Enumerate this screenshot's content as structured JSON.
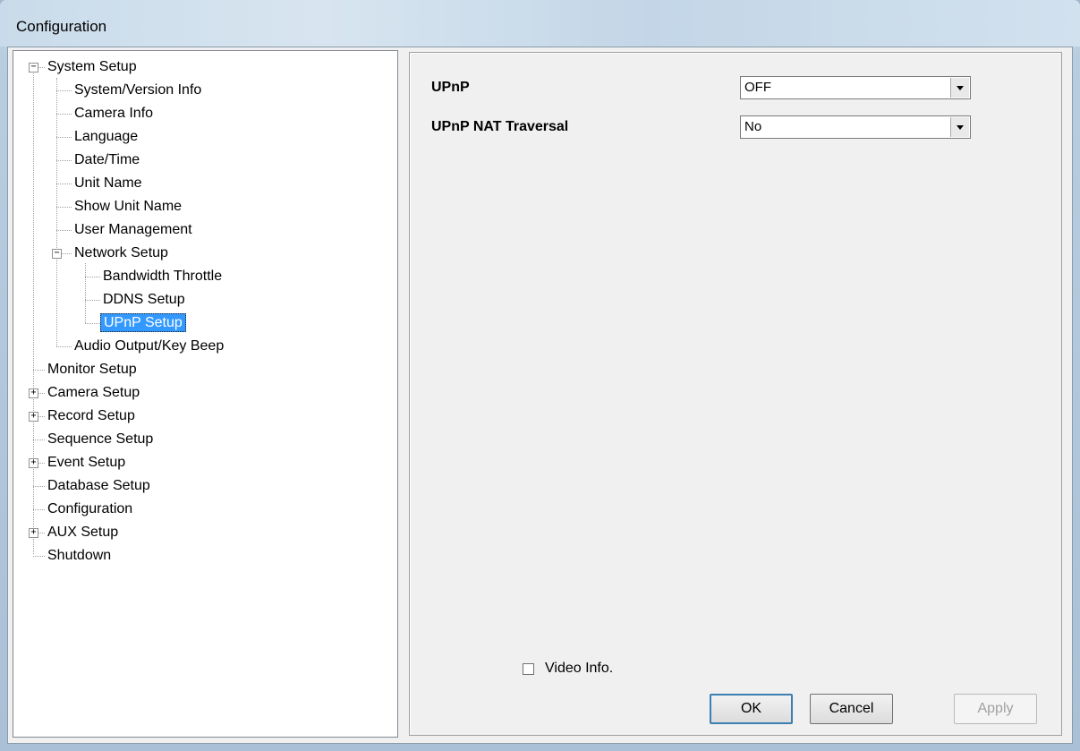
{
  "window": {
    "title": "Configuration"
  },
  "tree": {
    "items": [
      {
        "label": "System Setup",
        "level": 0,
        "expander": "minus"
      },
      {
        "label": "System/Version Info",
        "level": 1
      },
      {
        "label": "Camera Info",
        "level": 1
      },
      {
        "label": "Language",
        "level": 1
      },
      {
        "label": "Date/Time",
        "level": 1
      },
      {
        "label": "Unit Name",
        "level": 1
      },
      {
        "label": "Show Unit Name",
        "level": 1
      },
      {
        "label": "User Management",
        "level": 1
      },
      {
        "label": "Network Setup",
        "level": 1,
        "expander": "minus"
      },
      {
        "label": "Bandwidth Throttle",
        "level": 2
      },
      {
        "label": "DDNS Setup",
        "level": 2
      },
      {
        "label": "UPnP Setup",
        "level": 2,
        "selected": true
      },
      {
        "label": "Audio Output/Key Beep",
        "level": 1
      },
      {
        "label": "Monitor Setup",
        "level": 0
      },
      {
        "label": "Camera Setup",
        "level": 0,
        "expander": "plus"
      },
      {
        "label": "Record Setup",
        "level": 0,
        "expander": "plus"
      },
      {
        "label": "Sequence Setup",
        "level": 0
      },
      {
        "label": "Event Setup",
        "level": 0,
        "expander": "plus"
      },
      {
        "label": "Database Setup",
        "level": 0
      },
      {
        "label": "Configuration",
        "level": 0
      },
      {
        "label": "AUX Setup",
        "level": 0,
        "expander": "plus"
      },
      {
        "label": "Shutdown",
        "level": 0
      }
    ]
  },
  "settings": {
    "upnp": {
      "label": "UPnP",
      "value": "OFF"
    },
    "nat": {
      "label": "UPnP NAT Traversal",
      "value": "No"
    }
  },
  "video_info": {
    "label": "Video Info.",
    "checked": false
  },
  "buttons": {
    "ok": "OK",
    "cancel": "Cancel",
    "apply": "Apply"
  }
}
